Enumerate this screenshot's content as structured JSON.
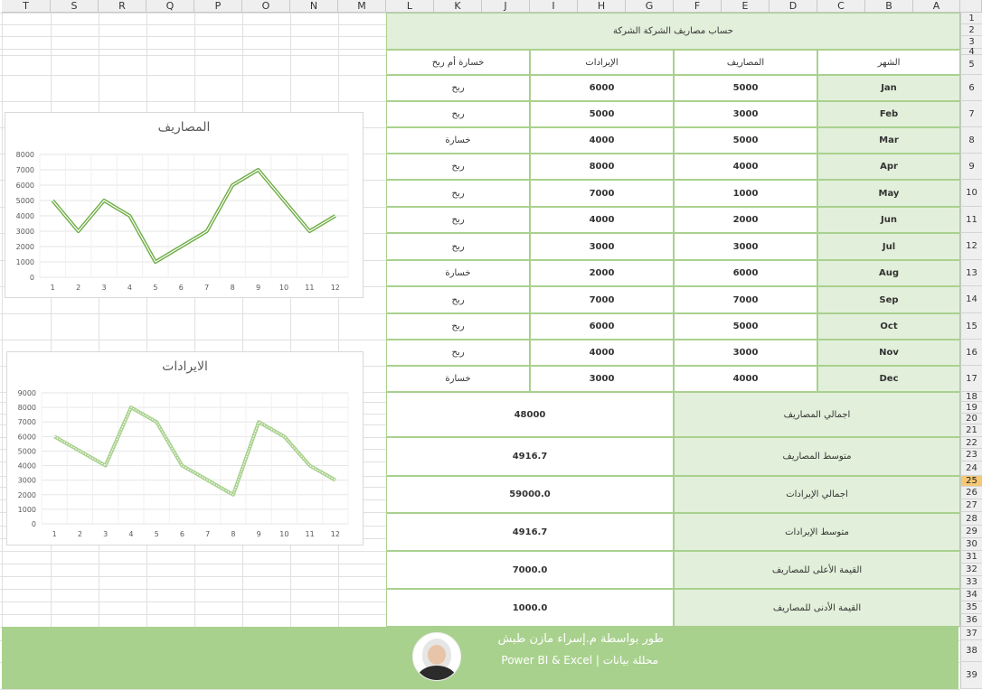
{
  "columns": [
    "T",
    "S",
    "R",
    "Q",
    "P",
    "O",
    "N",
    "M",
    "L",
    "K",
    "J",
    "I",
    "H",
    "G",
    "F",
    "E",
    "D",
    "C",
    "B",
    "A"
  ],
  "rows": [
    "1",
    "2",
    "3",
    "4",
    "5",
    "6",
    "7",
    "8",
    "9",
    "10",
    "11",
    "12",
    "13",
    "14",
    "15",
    "16",
    "17",
    "18",
    "19",
    "20",
    "21",
    "22",
    "23",
    "24",
    "25",
    "26",
    "27",
    "28",
    "29",
    "30",
    "31",
    "32",
    "33",
    "34",
    "35",
    "36",
    "37",
    "38",
    "39"
  ],
  "selected_row": "25",
  "table": {
    "title": "حساب مصاريف الشركة الشركة",
    "headers": {
      "month": "الشهر",
      "expenses": "المصاريف",
      "revenue": "الإيرادات",
      "status": "خسارة أم ربح"
    },
    "rows": [
      {
        "month": "Jan",
        "expenses": "5000",
        "revenue": "6000",
        "status": "ربح"
      },
      {
        "month": "Feb",
        "expenses": "3000",
        "revenue": "5000",
        "status": "ربح"
      },
      {
        "month": "Mar",
        "expenses": "5000",
        "revenue": "4000",
        "status": "خسارة"
      },
      {
        "month": "Apr",
        "expenses": "4000",
        "revenue": "8000",
        "status": "ربح"
      },
      {
        "month": "May",
        "expenses": "1000",
        "revenue": "7000",
        "status": "ربح"
      },
      {
        "month": "Jun",
        "expenses": "2000",
        "revenue": "4000",
        "status": "ربح"
      },
      {
        "month": "Jul",
        "expenses": "3000",
        "revenue": "3000",
        "status": "ربح"
      },
      {
        "month": "Aug",
        "expenses": "6000",
        "revenue": "2000",
        "status": "خسارة"
      },
      {
        "month": "Sep",
        "expenses": "7000",
        "revenue": "7000",
        "status": "ربح"
      },
      {
        "month": "Oct",
        "expenses": "5000",
        "revenue": "6000",
        "status": "ربح"
      },
      {
        "month": "Nov",
        "expenses": "3000",
        "revenue": "4000",
        "status": "ربح"
      },
      {
        "month": "Dec",
        "expenses": "4000",
        "revenue": "3000",
        "status": "خسارة"
      }
    ]
  },
  "summary": [
    {
      "label": "اجمالي المصاريف",
      "value": "48000"
    },
    {
      "label": "متوسط المصاريف",
      "value": "4916.7"
    },
    {
      "label": "اجمالي الإيرادات",
      "value": "59000.0"
    },
    {
      "label": "متوسط الإيرادات",
      "value": "4916.7"
    },
    {
      "label": "القيمة الأعلى للمصاريف",
      "value": "7000.0"
    },
    {
      "label": "القيمة الأدنى للمصاريف",
      "value": "1000.0"
    }
  ],
  "footer": {
    "line1": "طور بواسطة م.إسراء مازن طبش",
    "line2": "محللة بيانات | Power BI & Excel",
    "bg_color": "#a9d18e"
  },
  "chart_data": [
    {
      "type": "line",
      "title": "المصاريف",
      "x": [
        1,
        2,
        3,
        4,
        5,
        6,
        7,
        8,
        9,
        10,
        11,
        12
      ],
      "ylim": [
        0,
        8000
      ],
      "yticks": [
        0,
        1000,
        2000,
        3000,
        4000,
        5000,
        6000,
        7000,
        8000
      ],
      "series": [
        {
          "values": [
            5000,
            3000,
            5000,
            4000,
            1000,
            2000,
            3000,
            6000,
            7000,
            5000,
            3000,
            4000
          ]
        }
      ],
      "color": "#70ad47",
      "grid": true
    },
    {
      "type": "line",
      "title": "الايرادات",
      "x": [
        1,
        2,
        3,
        4,
        5,
        6,
        7,
        8,
        9,
        10,
        11,
        12
      ],
      "ylim": [
        0,
        9000
      ],
      "yticks": [
        0,
        1000,
        2000,
        3000,
        4000,
        5000,
        6000,
        7000,
        8000,
        9000
      ],
      "series": [
        {
          "values": [
            6000,
            5000,
            4000,
            8000,
            7000,
            4000,
            3000,
            2000,
            7000,
            6000,
            4000,
            3000
          ]
        }
      ],
      "color": "#a9d18e",
      "grid": true
    }
  ]
}
